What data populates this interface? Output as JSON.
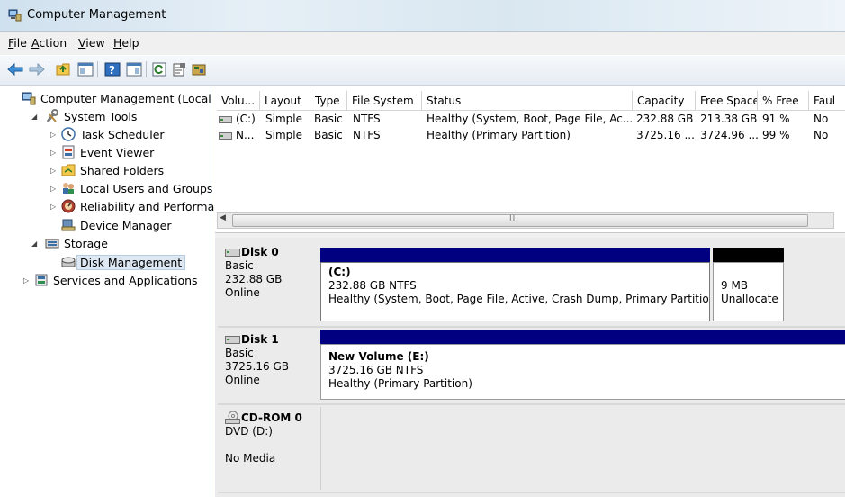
{
  "window": {
    "title": "Computer Management"
  },
  "menu": [
    {
      "u": "F",
      "rest": "ile"
    },
    {
      "u": "A",
      "rest": "ction"
    },
    {
      "u": "V",
      "rest": "iew"
    },
    {
      "u": "H",
      "rest": "elp"
    }
  ],
  "tree": {
    "root": "Computer Management (Local",
    "system_tools": "System Tools",
    "task_scheduler": "Task Scheduler",
    "event_viewer": "Event Viewer",
    "shared_folders": "Shared Folders",
    "local_users": "Local Users and Groups",
    "reliability": "Reliability and Performa",
    "device_manager": "Device Manager",
    "storage": "Storage",
    "disk_management": "Disk Management",
    "services": "Services and Applications"
  },
  "columns": [
    "Volu...",
    "Layout",
    "Type",
    "File System",
    "Status",
    "Capacity",
    "Free Space",
    "% Free",
    "Faul"
  ],
  "volumes": [
    [
      "(C:)",
      "Simple",
      "Basic",
      "NTFS",
      "Healthy (System, Boot, Page File, Ac...",
      "232.88 GB",
      "213.38 GB",
      "91 %",
      "No"
    ],
    [
      "N...",
      "Simple",
      "Basic",
      "NTFS",
      "Healthy (Primary Partition)",
      "3725.16 ...",
      "3724.96 ...",
      "99 %",
      "No"
    ]
  ],
  "scroll_glyph": "III",
  "disks": {
    "d0": {
      "name": "Disk 0",
      "type": "Basic",
      "size": "232.88 GB",
      "status": "Online",
      "p1": {
        "title": "(C:)",
        "fs": "232.88 GB NTFS",
        "health": "Healthy (System, Boot, Page File, Active, Crash Dump, Primary Partition"
      },
      "p2": {
        "size": "9 MB",
        "label": "Unallocate"
      }
    },
    "d1": {
      "name": "Disk 1",
      "type": "Basic",
      "size": "3725.16 GB",
      "status": "Online",
      "p1": {
        "title": "New Volume  (E:)",
        "fs": "3725.16 GB NTFS",
        "health": "Healthy (Primary Partition)"
      }
    },
    "cd": {
      "name": "CD-ROM 0",
      "type": "DVD (D:)",
      "status": "No Media"
    }
  },
  "colors": {
    "primary_partition": "#000080",
    "unallocated": "#000000",
    "selection": "#dde8f2"
  }
}
